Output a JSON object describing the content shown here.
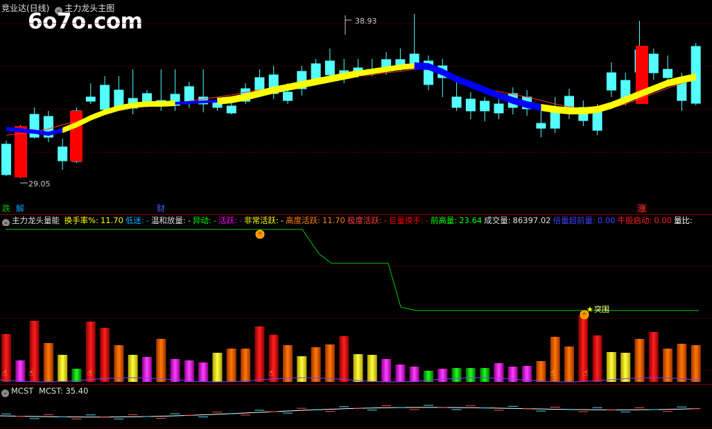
{
  "main_panel": {
    "title": "竞业达(日线)",
    "indicator": "主力龙头主图",
    "watermark": "6o7o.com",
    "high_label": "38.93",
    "low_label": "29.05",
    "events": [
      {
        "label": "跌",
        "color": "#00c000"
      },
      {
        "label": "解",
        "color": "#00a0ff"
      },
      {
        "label": "财",
        "color": "#4060ff"
      },
      {
        "label": "涨",
        "color": "#c00000"
      }
    ]
  },
  "volume_panel": {
    "title": "主力龙头量能",
    "fields": [
      {
        "label": "换手率%:",
        "value": "11.70",
        "color": "#ffff00"
      },
      {
        "label": "低迷:",
        "value": "-",
        "color": "#00aaff"
      },
      {
        "label": "温和放量:",
        "value": "-",
        "color": "#e0e0e0"
      },
      {
        "label": "异动:",
        "value": "-",
        "color": "#00ff00"
      },
      {
        "label": "活跃:",
        "value": "-",
        "color": "#ff00ff"
      },
      {
        "label": "非常活跃:",
        "value": "-",
        "color": "#ffff00"
      },
      {
        "label": "高度活跃:",
        "value": "11.70",
        "color": "#ff8000"
      },
      {
        "label": "极度活跃:",
        "value": "-",
        "color": "#ff4040"
      },
      {
        "label": "巨量换手:",
        "value": "-",
        "color": "#ff0000"
      },
      {
        "label": "前高量:",
        "value": "23.64",
        "color": "#00ff00"
      },
      {
        "label": "成交量:",
        "value": "86397.02",
        "color": "#e0e0e0"
      },
      {
        "label": "倍量超前量:",
        "value": "0.00",
        "color": "#4040ff"
      },
      {
        "label": "牛股启动:",
        "value": "0.00",
        "color": "#ff2020"
      },
      {
        "label": "量比:",
        "value": "",
        "color": "#ffffff"
      }
    ],
    "breakout_label": "突围"
  },
  "mcst_panel": {
    "title": "MCST",
    "label": "MCST:",
    "value": "35.40"
  },
  "colors": {
    "up": "#ff0000",
    "down": "#54ffff",
    "ma_up": "#ffff00",
    "ma_down": "#0000ff",
    "slow_ma": "#ff3030",
    "step_line": "#00cc00"
  }
}
